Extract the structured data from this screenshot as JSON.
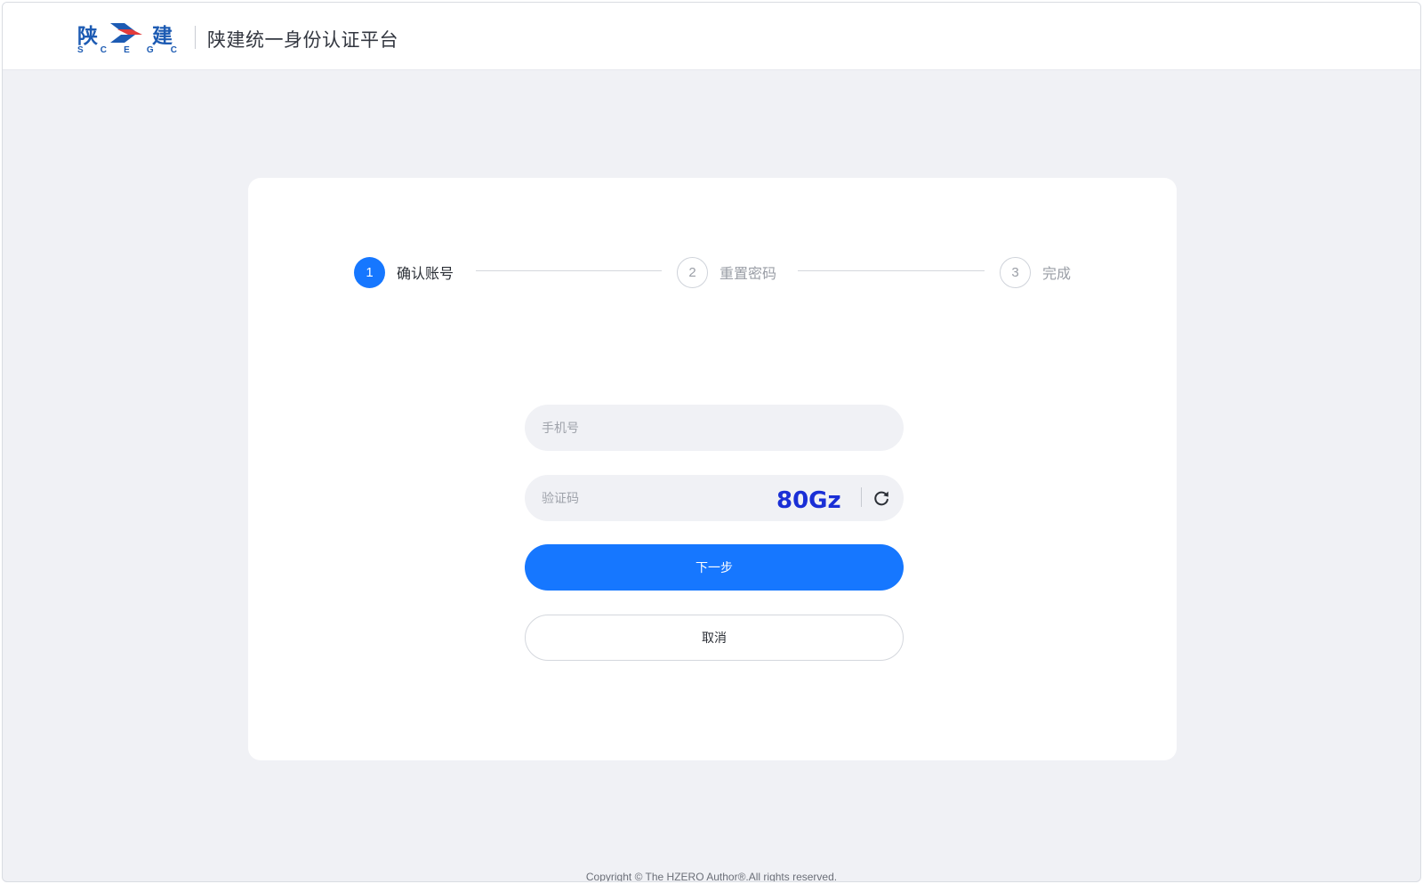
{
  "header": {
    "logo_cn_left": "陕",
    "logo_cn_right": "建",
    "logo_en": [
      "S",
      "C",
      "E",
      "G",
      "C"
    ],
    "title": "陕建统一身份认证平台"
  },
  "steps": [
    {
      "number": "1",
      "label": "确认账号",
      "state": "active"
    },
    {
      "number": "2",
      "label": "重置密码",
      "state": "pending"
    },
    {
      "number": "3",
      "label": "完成",
      "state": "pending"
    }
  ],
  "form": {
    "phone_placeholder": "手机号",
    "captcha_placeholder": "验证码",
    "captcha_text": "80Gz",
    "next_label": "下一步",
    "cancel_label": "取消"
  },
  "footer": {
    "copyright": "Copyright © The HZERO Author®.All rights reserved."
  },
  "colors": {
    "primary": "#1677ff",
    "background": "#f0f1f5",
    "logo_blue": "#1d5bb3",
    "logo_red": "#e23b3b",
    "captcha_blue": "#1a2fd6"
  }
}
